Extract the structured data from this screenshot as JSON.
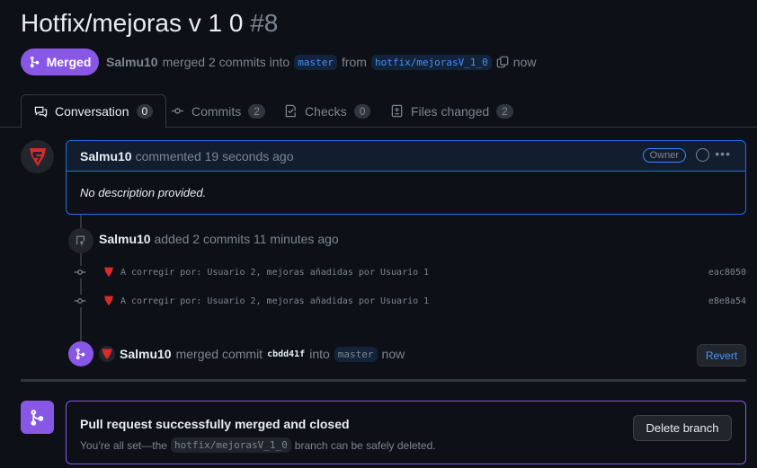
{
  "pr": {
    "title": "Hotfix/mejoras v 1 0",
    "number": "#8",
    "state": "Merged",
    "author": "Salmu10",
    "merged_text": "merged 2 commits into",
    "base_branch": "master",
    "from_text": "from",
    "head_branch": "hotfix/mejorasV_1_0",
    "time": "now"
  },
  "tabs": [
    {
      "label": "Conversation",
      "count": "0",
      "icon": "comment-discussion-icon"
    },
    {
      "label": "Commits",
      "count": "2",
      "icon": "git-commit-icon"
    },
    {
      "label": "Checks",
      "count": "0",
      "icon": "checklist-icon"
    },
    {
      "label": "Files changed",
      "count": "2",
      "icon": "file-diff-icon"
    }
  ],
  "comment": {
    "author": "Salmu10",
    "action": "commented 19 seconds ago",
    "role": "Owner",
    "body": "No description provided."
  },
  "push_event": {
    "author": "Salmu10",
    "text": "added 2 commits 11 minutes ago"
  },
  "commits": [
    {
      "message": "A corregir por: Usuario 2, mejoras añadidas por Usuario 1",
      "sha": "eac8050"
    },
    {
      "message": "A corregir por: Usuario 2, mejoras añadidas por Usuario 1",
      "sha": "e8e8a54"
    }
  ],
  "merge_event": {
    "author": "Salmu10",
    "text": "merged commit",
    "sha": "cbdd41f",
    "into": "into",
    "branch": "master",
    "time": "now",
    "revert_label": "Revert"
  },
  "merge_box": {
    "title": "Pull request successfully merged and closed",
    "sub_before": "You’re all set—the",
    "branch": "hotfix/mejorasV_1_0",
    "sub_after": "branch can be safely deleted.",
    "delete_label": "Delete branch"
  },
  "colors": {
    "merged_purple": "#8957e5",
    "link_blue": "#4493f8",
    "avatar_red": "#da2a2a"
  }
}
